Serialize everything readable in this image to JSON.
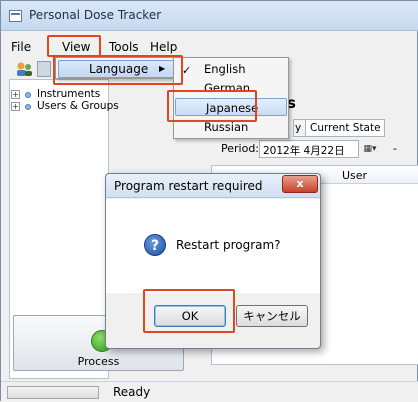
{
  "window": {
    "title": "Personal Dose Tracker"
  },
  "menu": {
    "file": "File",
    "view": "View",
    "tools": "Tools",
    "help": "Help"
  },
  "view_menu": {
    "language": "Language"
  },
  "language_menu": {
    "items": [
      {
        "label": "English",
        "checked": true
      },
      {
        "label": "German",
        "checked": false
      },
      {
        "label": "Japanese",
        "checked": false,
        "selected": true
      },
      {
        "label": "Russian",
        "checked": false
      }
    ],
    "check_glyph": "✓"
  },
  "tree": {
    "items": [
      "Instruments",
      "Users & Groups"
    ]
  },
  "tabs": {
    "partial": "y",
    "current_state": "Current State"
  },
  "filter": {
    "period_label": "Period:",
    "date_value": "2012年 4月22日",
    "dash": "-"
  },
  "grid": {
    "column_user": "User"
  },
  "partial_heading": "s",
  "process": {
    "label": "Process"
  },
  "status": {
    "text": "Ready"
  },
  "dialog": {
    "title": "Program restart required",
    "close": "x",
    "message": "Restart program?",
    "ok": "OK",
    "cancel": "キャンセル"
  },
  "colors": {
    "highlight_box": "#e0461f",
    "accent": "#3c7fb1"
  }
}
